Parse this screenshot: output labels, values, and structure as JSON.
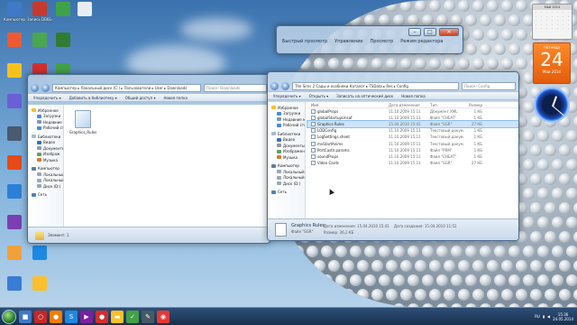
{
  "desktop_icons": [
    {
      "label": "Компьютер",
      "color": "#3f79c8"
    },
    {
      "label": "Запись DB6E47C",
      "color": "#c63a2e"
    },
    {
      "label": "",
      "color": "#3fa24a"
    },
    {
      "label": "",
      "color": "#e8edf2"
    },
    {
      "label": "",
      "color": "#f05a32"
    },
    {
      "label": "",
      "color": "#4aa64f"
    },
    {
      "label": "",
      "color": "#f4c21f"
    },
    {
      "label": "",
      "color": "#6a5fd6"
    },
    {
      "label": "",
      "color": "#2f9e3e"
    },
    {
      "label": "",
      "color": "#4a5a71"
    },
    {
      "label": "",
      "color": "#e64a19"
    },
    {
      "label": "",
      "color": "#2c7fd8"
    },
    {
      "label": "",
      "color": "#7b3fb3"
    },
    {
      "label": "",
      "color": "#f2a03a"
    },
    {
      "label": "",
      "color": "#1e88e5"
    },
    {
      "label": "",
      "color": "#3a7bd5"
    },
    {
      "label": "",
      "color": "#fbc02d"
    },
    {
      "label": "",
      "color": "#2e7d32"
    },
    {
      "label": "",
      "color": "#d32f2f"
    },
    {
      "label": "",
      "color": "#43a047"
    },
    {
      "label": "",
      "color": "#1565c0"
    },
    {
      "label": "",
      "color": "#3a3a3a"
    }
  ],
  "window_back": {
    "buttons": [
      "Быстрый просмотр",
      "Управление",
      "Просмотр",
      "Режим редактора"
    ]
  },
  "window_left": {
    "address": "Компьютер ▸ Локальный диск (C:) ▸ Пользователи ▸ User ▸ Downloads",
    "search": "Поиск: Downloads",
    "commands": [
      "Упорядочить ▾",
      "Добавить в библиотеку ▾",
      "Общий доступ ▾",
      "Новая папка"
    ],
    "nav": {
      "favorites": "Избранное",
      "favorites_items": [
        "Загрузки",
        "Недавние",
        "Рабочий стол"
      ],
      "libraries": "Библиотеки",
      "libraries_items": [
        "Видео",
        "Документы",
        "Изображ",
        "Музыка"
      ],
      "computer": "Компьютер",
      "computer_items": [
        "Локальный",
        "Локальный",
        "Диск (D:)"
      ],
      "network": "Сеть"
    },
    "file": "Graphics_Rules",
    "status": "Элемент: 1"
  },
  "window_right": {
    "address": "The Sims 2 Сады и особняки Каталог ▸ TSData ▸ Res ▸ Config",
    "search": "Поиск: Config",
    "commands": [
      "Упорядочить ▾",
      "Открыть ▾",
      "Записать на оптический диск",
      "Новая папка"
    ],
    "columns": [
      "Имя",
      "Дата изменения",
      "Тип",
      "Размер"
    ],
    "files": [
      {
        "name": "globalProps",
        "date": "11.10.2009 15:11",
        "type": "Документ XML",
        "size": "1 КБ"
      },
      {
        "name": "globalStartupUnsaf",
        "date": "11.10.2009 15:11",
        "type": "Файл \"CHEAT\"",
        "size": "1 КБ"
      },
      {
        "name": "Graphics Rules",
        "date": "15.04.2010 15:41",
        "type": "Файл \"SGR\"",
        "size": "27 КБ"
      },
      {
        "name": "LODConfig",
        "date": "11.10.2009 15:11",
        "type": "Текстовый докум...",
        "size": "1 КБ"
      },
      {
        "name": "LogSettings.sheet",
        "date": "11.10.2009 15:11",
        "type": "Текстовый докум...",
        "size": "1 КБ"
      },
      {
        "name": "mvStartAnims",
        "date": "11.10.2009 15:11",
        "type": "Текстовый докум...",
        "size": "1 КБ"
      },
      {
        "name": "PortCastlr.params",
        "date": "11.10.2009 15:11",
        "type": "Файл \"PRM\"",
        "size": "1 КБ"
      },
      {
        "name": "soundProps",
        "date": "11.10.2009 15:11",
        "type": "Файл \"CHEAT\"",
        "size": "1 КБ"
      },
      {
        "name": "Video Cards",
        "date": "11.10.2009 15:11",
        "type": "Файл \"SGR\"",
        "size": "27 КБ"
      }
    ],
    "nav": {
      "favorites": "Избранное",
      "favorites_items": [
        "Загрузки",
        "Недавние места",
        "Рабочий стол"
      ],
      "libraries": "Библиотеки",
      "libraries_items": [
        "Видео",
        "Документы",
        "Изображения",
        "Музыка"
      ],
      "computer": "Компьютер",
      "computer_items": [
        "Локальный диск",
        "Локальный диск",
        "Диск (D:)"
      ],
      "network": "Сеть"
    },
    "details": {
      "name": "Graphics Rules",
      "modified_label": "Дата изменения: 15.04.2010 15:41",
      "created_label": "Дата создания: 15.04.2010 11:52",
      "type": "Файл \"SGR\"",
      "size_label": "Размер: 26,2 КБ"
    }
  },
  "gadgets": {
    "calendar_title": "Май 2014",
    "weekday": "пятница",
    "day": "24",
    "month_year": "Май 2014"
  },
  "taskbar": {
    "lang": "RU",
    "time": "15:36",
    "date": "24.05.2014"
  }
}
